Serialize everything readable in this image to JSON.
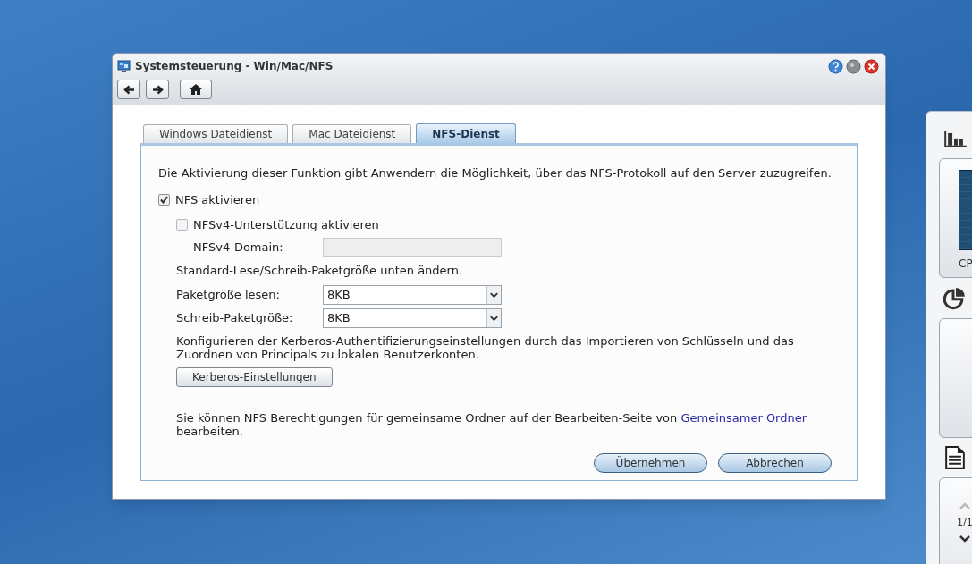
{
  "window": {
    "title": "Systemsteuerung - Win/Mac/NFS"
  },
  "tabs": [
    {
      "label": "Windows Dateidienst",
      "selected": false
    },
    {
      "label": "Mac Dateidienst",
      "selected": false
    },
    {
      "label": "NFS-Dienst",
      "selected": true
    }
  ],
  "description": "Die Aktivierung dieser Funktion gibt Anwendern die Möglichkeit, über das NFS-Protokoll auf den Server zuzugreifen.",
  "nfs_enable": {
    "label": "NFS aktivieren",
    "checked": true
  },
  "nfsv4_enable": {
    "label": "NFSv4-Unterstützung aktivieren",
    "checked": false
  },
  "nfsv4_domain": {
    "label": "NFSv4-Domain:",
    "disabled": true
  },
  "packet_note": "Standard-Lese/Schreib-Paketgröße unten ändern.",
  "read_size": {
    "label": "Paketgröße lesen:",
    "value": "8KB"
  },
  "write_size": {
    "label": "Schreib-Paketgröße:",
    "value": "8KB"
  },
  "kerberos_note": "Konfigurieren der Kerberos-Authentifizierungseinstellungen durch das Importieren von Schlüsseln und das Zuordnen von Principals zu lokalen Benutzerkonten.",
  "kerberos_button": "Kerberos-Einstellungen",
  "permission_note": {
    "before": "Sie können NFS Berechtigungen für gemeinsame Ordner auf der Bearbeiten-Seite von ",
    "link": "Gemeinsamer Ordner",
    "after": " bearbeiten."
  },
  "buttons": [
    "Übernehmen",
    "Abbrechen"
  ],
  "side_panel": {
    "cpu_label": "CP",
    "page": "1/1"
  }
}
